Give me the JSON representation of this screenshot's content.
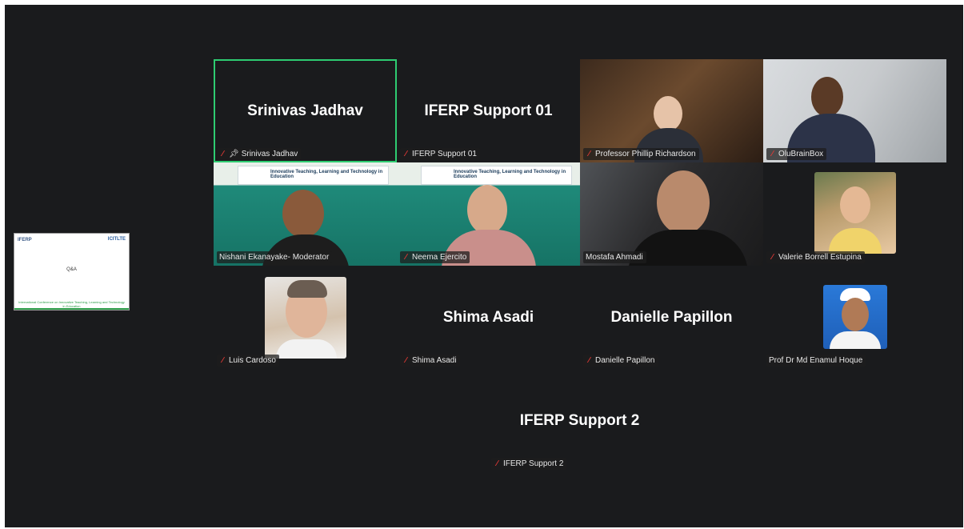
{
  "share_preview": {
    "logo_left": "IFERP",
    "logo_right": "ICITLTE",
    "slide_title": "Q&A",
    "footer": "International Conference on Innovative Teaching, Learning and Technology in Education"
  },
  "participants": [
    {
      "name": "Srinivas Jadhav",
      "label": "Srinivas Jadhav",
      "video": false,
      "muted": true,
      "pinned": true,
      "active_speaker": true
    },
    {
      "name": "IFERP Support 01",
      "label": "IFERP Support 01",
      "video": false,
      "muted": true
    },
    {
      "name": "Professor Phillip Richardson",
      "label": "Professor Phillip Richardson",
      "video": true,
      "muted": true
    },
    {
      "name": "OluBrainBox",
      "label": "OluBrainBox",
      "video": true,
      "muted": true
    },
    {
      "name": "Nishani Ekanayake- Moderator",
      "label": "Nishani Ekanayake- Moderator",
      "video": true,
      "muted": false
    },
    {
      "name": "Neema Ejercito",
      "label": "Neema Ejercito",
      "video": true,
      "muted": true
    },
    {
      "name": "Mostafa Ahmadi",
      "label": "Mostafa Ahmadi",
      "video": true,
      "muted": false
    },
    {
      "name": "Valerie Borrell Estupina",
      "label": "Valerie Borrell Estupina",
      "video": false,
      "avatar": true,
      "muted": true
    },
    {
      "name": "Luis Cardoso",
      "label": "Luis Cardoso",
      "video": false,
      "avatar": true,
      "muted": true
    },
    {
      "name": "Shima Asadi",
      "label": "Shima Asadi",
      "video": false,
      "muted": true
    },
    {
      "name": "Danielle Papillon",
      "label": "Danielle Papillon",
      "video": false,
      "muted": true
    },
    {
      "name": "Prof Dr Md Enamul Hoque",
      "label": "Prof Dr Md Enamul Hoque",
      "video": false,
      "avatar": true,
      "muted": false
    },
    {
      "name": "IFERP Support 2",
      "label": "IFERP Support 2",
      "video": false,
      "muted": true
    }
  ],
  "banner_text": "Innovative Teaching, Learning and Technology in Education",
  "colors": {
    "background": "#1a1b1d",
    "active_border": "#2ecc71",
    "muted_icon": "#e53935"
  },
  "icons": {
    "muted": "mic-muted-icon",
    "pinned": "pin-icon"
  }
}
